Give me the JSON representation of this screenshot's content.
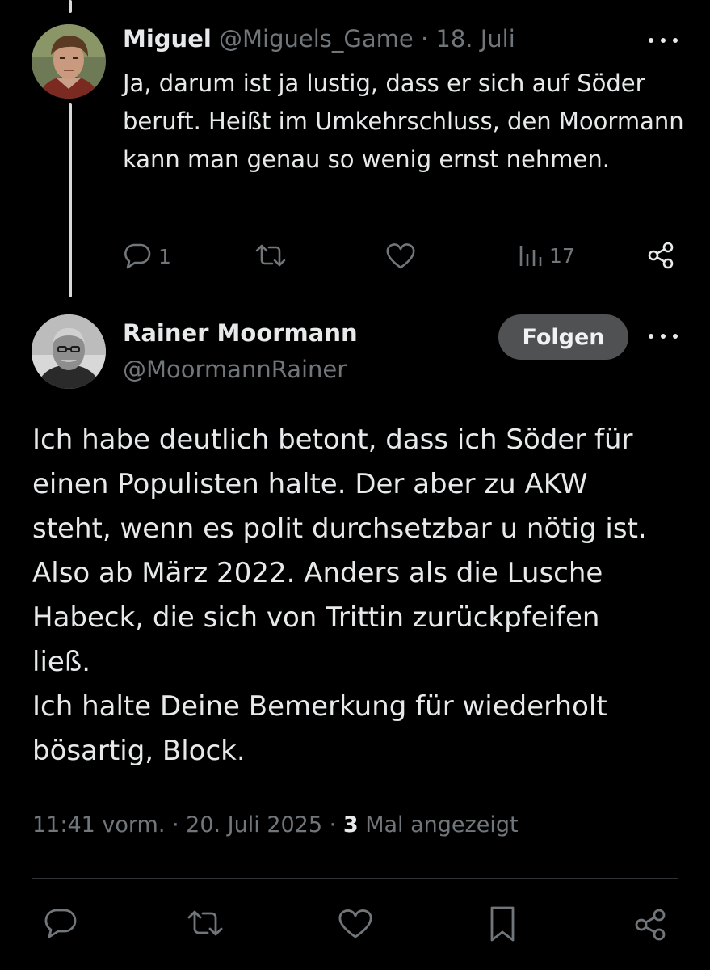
{
  "reply_tweet": {
    "author_name": "Miguel",
    "handle": "@Miguels_Game",
    "separator": "·",
    "date": "18. Juli",
    "text": "Ja, darum ist ja lustig, dass er sich auf Söder beruft. Heißt im Umkehrschluss, den Moormann kann man genau so wenig ernst nehmen.",
    "actions": {
      "reply_count": "1",
      "views_count": "17"
    }
  },
  "main_tweet": {
    "author_name": "Rainer Moormann",
    "handle": "@MoormannRainer",
    "follow_label": "Folgen",
    "text_lines": [
      "Ich habe deutlich betont, dass ich Söder für",
      "einen Populisten halte. Der aber zu AKW",
      "steht, wenn es polit durchsetzbar u nötig ist.",
      "Also ab März 2022. Anders als die Lusche",
      "Habeck, die sich von Trittin zurückpfeifen",
      "ließ.",
      "Ich halte Deine Bemerkung für wiederholt",
      "bösartig, Block."
    ],
    "timestamp": "11:41 vorm. · 20. Juli 2025 ·",
    "views_number": "3",
    "views_label": "Mal angezeigt"
  },
  "icons": {
    "reply": "reply-icon",
    "retweet": "retweet-icon",
    "like": "heart-icon",
    "views": "views-icon",
    "share": "share-icon",
    "bookmark": "bookmark-icon",
    "more": "more-icon"
  },
  "colors": {
    "background": "#000000",
    "text": "#e7e9ea",
    "muted": "#71767b",
    "follow_button": "#4f5153",
    "divider": "#2f3336"
  }
}
